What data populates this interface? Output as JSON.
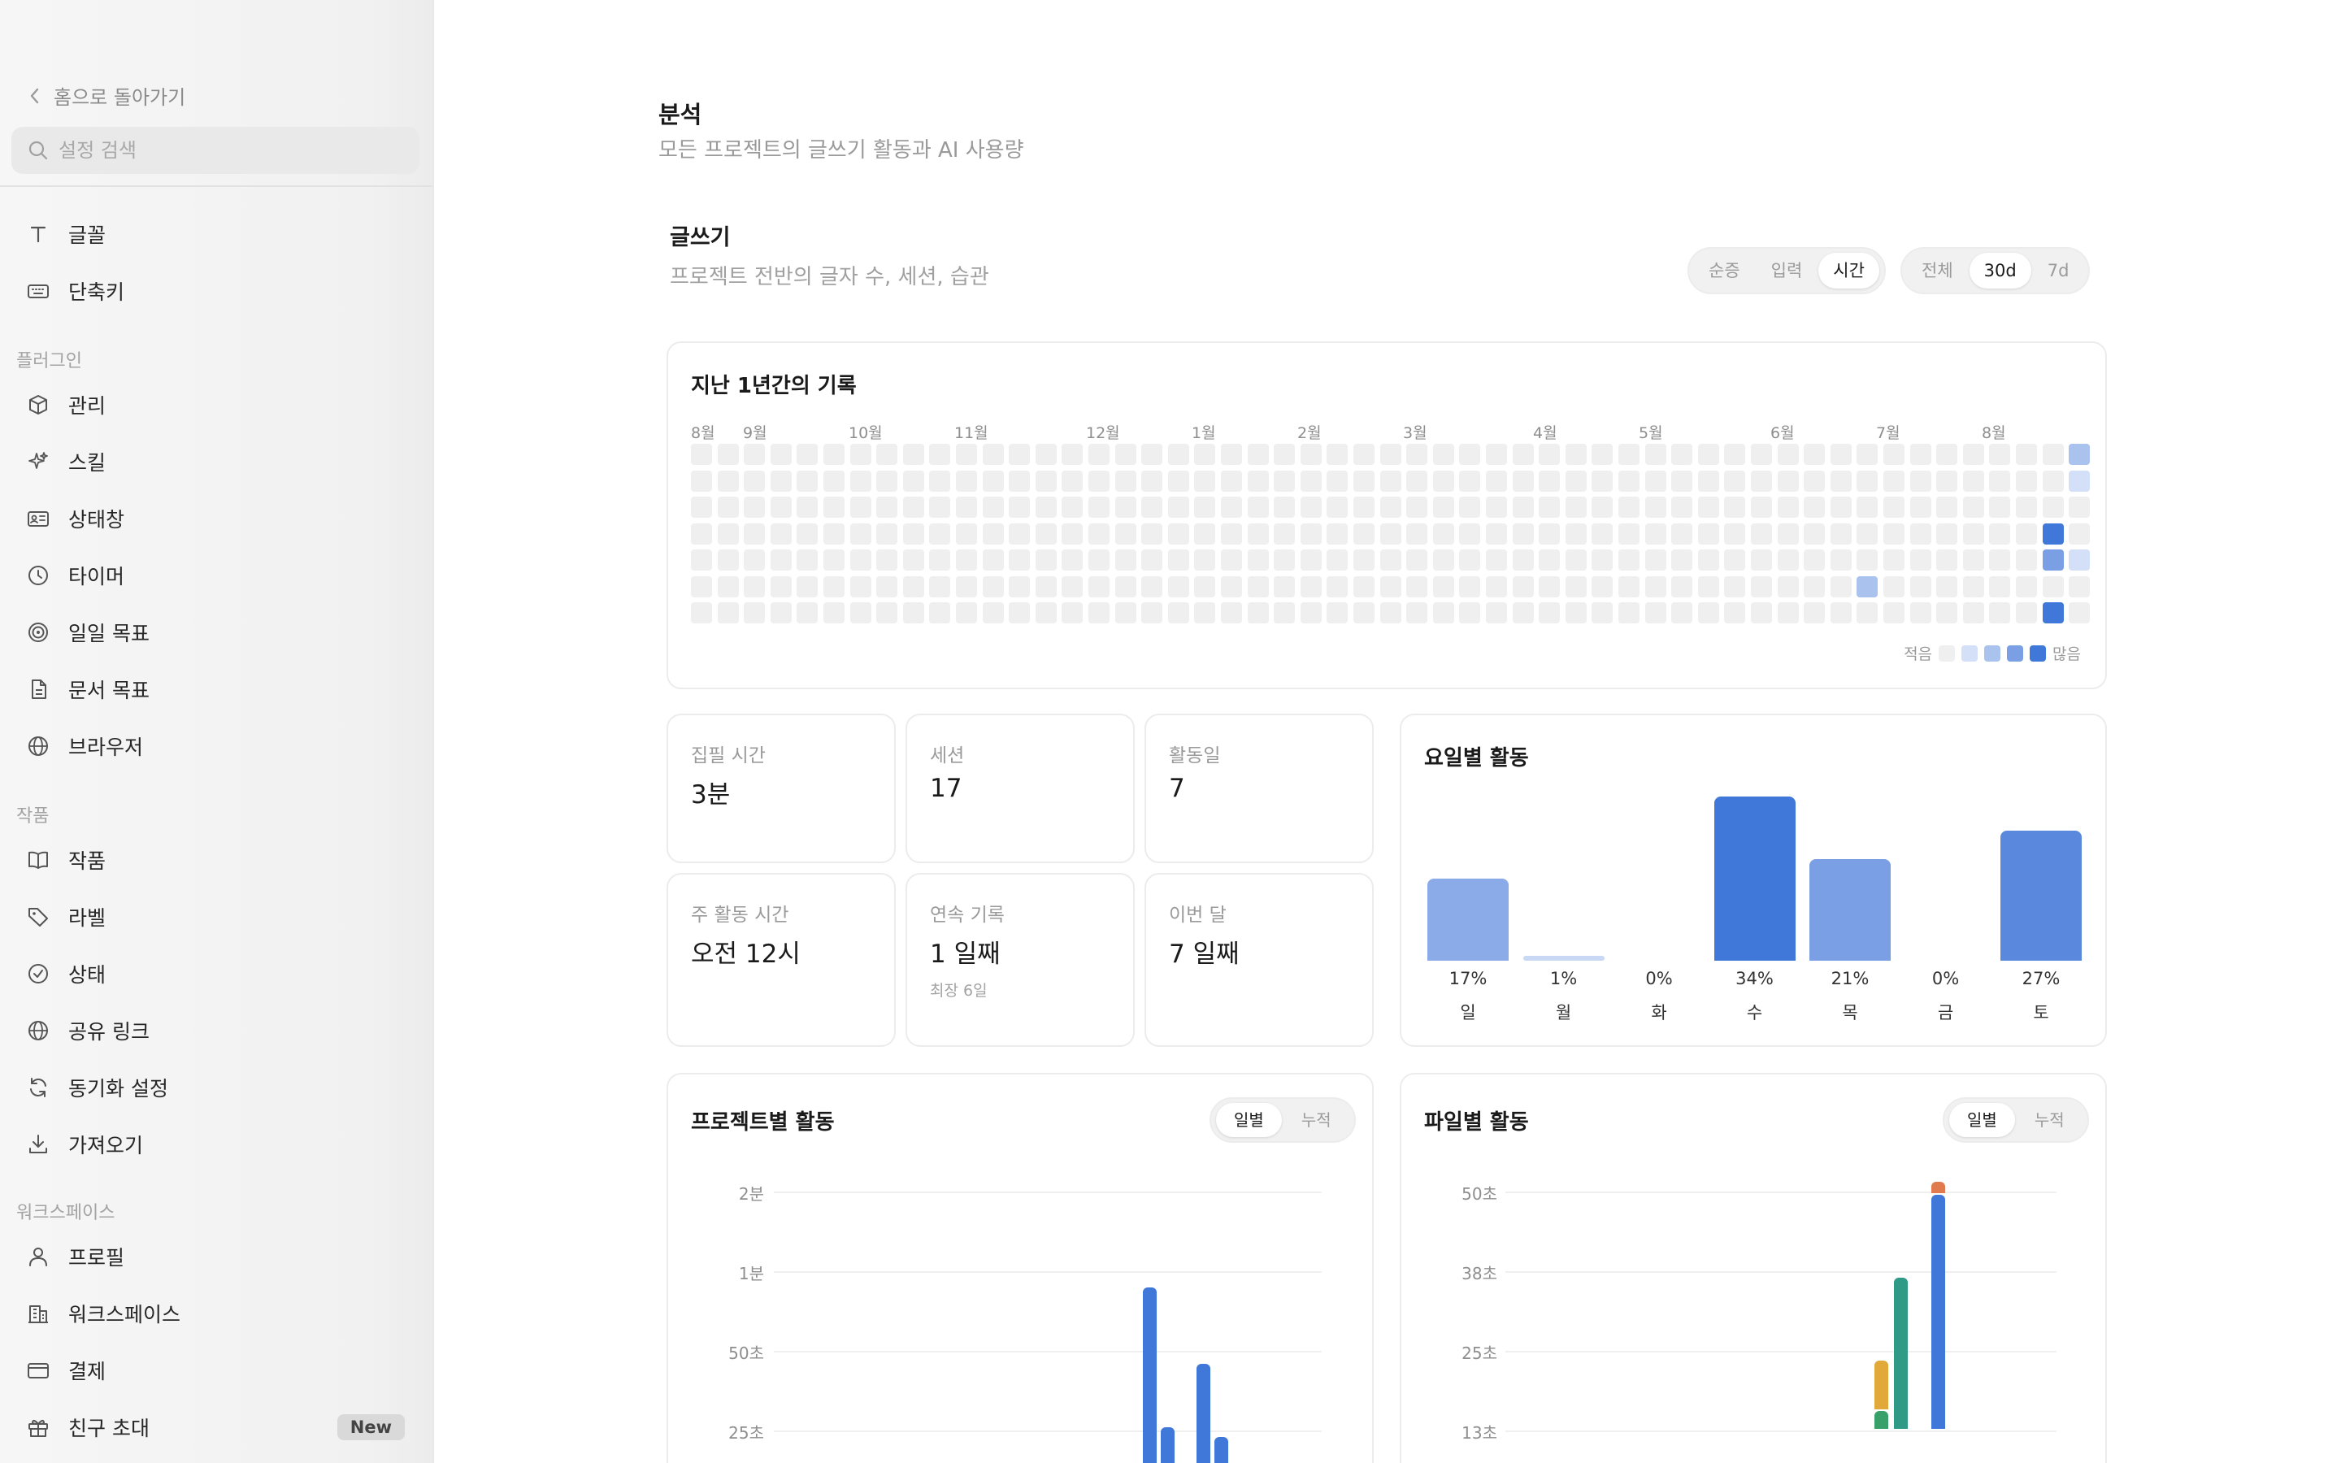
{
  "sidebar": {
    "back_label": "홈으로 돌아가기",
    "search_placeholder": "설정 검색",
    "items_top": [
      {
        "label": "글꼴",
        "icon": "font-icon"
      },
      {
        "label": "단축키",
        "icon": "keyboard-icon"
      }
    ],
    "group_plugins": "플러그인",
    "items_plugins": [
      {
        "label": "관리",
        "icon": "package-icon"
      },
      {
        "label": "스킬",
        "icon": "sparkle-icon"
      },
      {
        "label": "상태창",
        "icon": "id-card-icon"
      },
      {
        "label": "타이머",
        "icon": "clock-icon"
      },
      {
        "label": "일일 목표",
        "icon": "target-icon"
      },
      {
        "label": "문서 목표",
        "icon": "document-icon"
      },
      {
        "label": "브라우저",
        "icon": "globe-icon"
      }
    ],
    "group_works": "작품",
    "items_works": [
      {
        "label": "작품",
        "icon": "book-icon"
      },
      {
        "label": "라벨",
        "icon": "tag-icon"
      },
      {
        "label": "상태",
        "icon": "check-circle-icon"
      },
      {
        "label": "공유 링크",
        "icon": "globe-icon"
      },
      {
        "label": "동기화 설정",
        "icon": "sync-icon"
      },
      {
        "label": "가져오기",
        "icon": "download-icon"
      }
    ],
    "group_workspace": "워크스페이스",
    "items_workspace": [
      {
        "label": "프로필",
        "icon": "user-icon"
      },
      {
        "label": "워크스페이스",
        "icon": "building-icon"
      },
      {
        "label": "결제",
        "icon": "credit-card-icon"
      },
      {
        "label": "친구 초대",
        "icon": "gift-icon",
        "badge": "New"
      }
    ]
  },
  "page": {
    "title": "분석",
    "subtitle": "모든 프로젝트의 글쓰기 활동과 AI 사용량"
  },
  "writing": {
    "title": "글쓰기",
    "subtitle": "프로젝트 전반의 글자 수, 세션, 습관",
    "metric_options": [
      "순증",
      "입력",
      "시간"
    ],
    "metric_selected": "시간",
    "range_options": [
      "전체",
      "30d",
      "7d"
    ],
    "range_selected": "30d"
  },
  "heatmap": {
    "title": "지난 1년간의 기록",
    "months": [
      "8월",
      "9월",
      "10월",
      "11월",
      "12월",
      "1월",
      "2월",
      "3월",
      "4월",
      "5월",
      "6월",
      "7월",
      "8월"
    ],
    "legend_less": "적음",
    "legend_more": "많음",
    "levels": [
      "#efefef",
      "#d3e0f7",
      "#a9c2ee",
      "#7a9fe4",
      "#3f78d8"
    ],
    "active_cells": [
      {
        "week": 52,
        "day": 0,
        "level": 2
      },
      {
        "week": 52,
        "day": 1,
        "level": 1
      },
      {
        "week": 51,
        "day": 3,
        "level": 4
      },
      {
        "week": 51,
        "day": 4,
        "level": 3
      },
      {
        "week": 52,
        "day": 4,
        "level": 1
      },
      {
        "week": 44,
        "day": 5,
        "level": 2
      },
      {
        "week": 51,
        "day": 6,
        "level": 4
      }
    ]
  },
  "stats": [
    {
      "label": "집필 시간",
      "value": "3분"
    },
    {
      "label": "세션",
      "value": "17"
    },
    {
      "label": "활동일",
      "value": "7"
    },
    {
      "label": "주 활동 시간",
      "value": "오전 12시"
    },
    {
      "label": "연속 기록",
      "value": "1 일째",
      "note": "최장 6일"
    },
    {
      "label": "이번 달",
      "value": "7 일째"
    }
  ],
  "weekday": {
    "title": "요일별 활동",
    "days": [
      "일",
      "월",
      "화",
      "수",
      "목",
      "금",
      "토"
    ],
    "percent_labels": [
      "17%",
      "1%",
      "0%",
      "34%",
      "21%",
      "0%",
      "27%"
    ],
    "values": [
      17,
      1,
      0,
      34,
      21,
      0,
      27
    ],
    "colors": [
      "#8aaae8",
      "#c9d8f4",
      "#c9d8f4",
      "#3f78d8",
      "#7a9fe4",
      "#c9d8f4",
      "#5a88dd"
    ]
  },
  "project_activity": {
    "title": "프로젝트별 활동",
    "toggle": [
      "일별",
      "누적"
    ],
    "toggle_selected": "일별",
    "y_ticks": [
      "2분",
      "1분",
      "50초",
      "25초"
    ],
    "y_seconds": [
      120,
      60,
      50,
      25
    ],
    "bars": [
      {
        "seconds": 58,
        "color": "#3f78d8"
      },
      {
        "seconds": 26,
        "color": "#3f78d8"
      },
      {
        "seconds": 0,
        "color": "#3f78d8"
      },
      {
        "seconds": 46,
        "color": "#3f78d8"
      },
      {
        "seconds": 23,
        "color": "#3f78d8"
      }
    ]
  },
  "file_activity": {
    "title": "파일별 활동",
    "toggle": [
      "일별",
      "누적"
    ],
    "toggle_selected": "일별",
    "y_ticks": [
      "50초",
      "38초",
      "25초",
      "13초"
    ],
    "y_seconds": [
      50,
      38,
      25,
      13
    ],
    "stacks": [
      {
        "segments": [
          {
            "seconds": 3,
            "color": "#3aa06a"
          },
          {
            "seconds": 8,
            "color": "#e0a93a"
          }
        ]
      },
      {
        "segments": [
          {
            "seconds": 24,
            "color": "#2f9a86"
          }
        ]
      },
      {
        "segments": [
          {
            "seconds": 37,
            "color": "#3f78d8"
          },
          {
            "seconds": 2,
            "color": "#e07a4f"
          }
        ]
      }
    ]
  }
}
